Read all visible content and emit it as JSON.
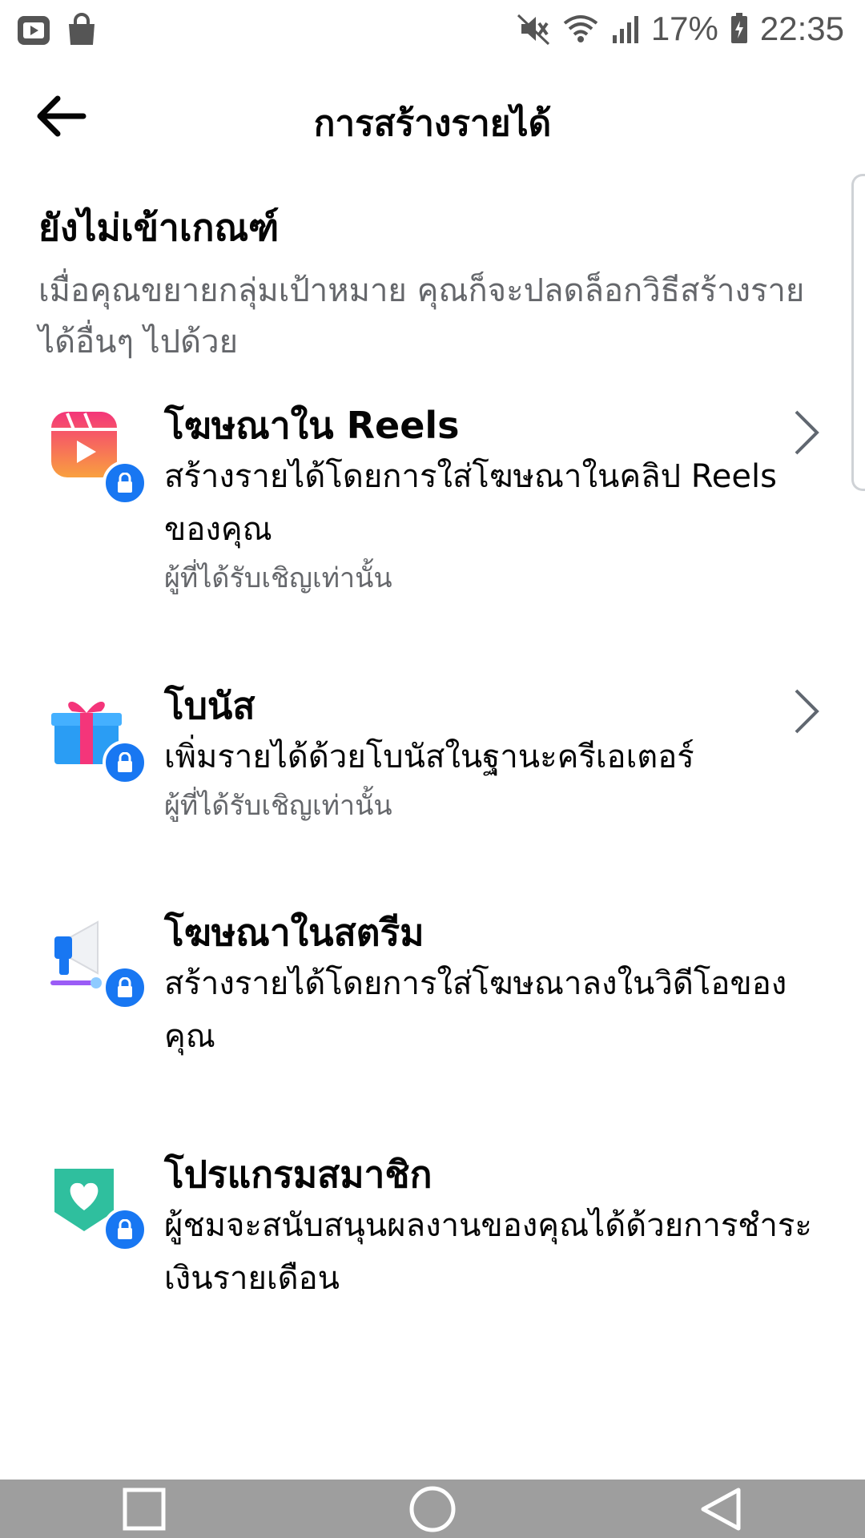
{
  "status_bar": {
    "battery": "17%",
    "time": "22:35"
  },
  "header": {
    "title": "การสร้างรายได้"
  },
  "intro": {
    "heading": "ยังไม่เข้าเกณฑ์",
    "description": "เมื่อคุณขยายกลุ่มเป้าหมาย คุณก็จะปลดล็อกวิธีสร้างรายได้อื่นๆ ไปด้วย"
  },
  "items": [
    {
      "title": "โฆษณาใน Reels",
      "description": "สร้างรายได้โดยการใส่โฆษณาในคลิป Reels ของคุณ",
      "note": "ผู้ที่ได้รับเชิญเท่านั้น",
      "icon": "reels-icon"
    },
    {
      "title": "โบนัส",
      "description": "เพิ่มรายได้ด้วยโบนัสในฐานะครีเอเตอร์",
      "note": "ผู้ที่ได้รับเชิญเท่านั้น",
      "icon": "gift-icon"
    },
    {
      "title": "โฆษณาในสตรีม",
      "description": "สร้างรายได้โดยการใส่โฆษณาลงในวิดีโอของคุณ",
      "icon": "megaphone-icon"
    },
    {
      "title": "โปรแกรมสมาชิก",
      "description": "ผู้ชมจะสนับสนุนผลงานของคุณได้ด้วยการชำระเงินรายเดือน",
      "icon": "heart-badge-icon"
    }
  ],
  "colors": {
    "lock_badge": "#1877f2",
    "secondary_text": "#65676b",
    "nav_bar": "#9e9e9e"
  }
}
